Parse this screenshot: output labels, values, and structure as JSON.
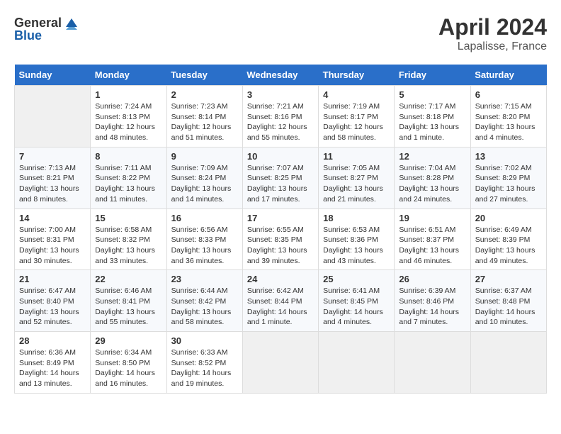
{
  "header": {
    "logo": {
      "general": "General",
      "blue": "Blue"
    },
    "title": "April 2024",
    "location": "Lapalisse, France"
  },
  "calendar": {
    "days_of_week": [
      "Sunday",
      "Monday",
      "Tuesday",
      "Wednesday",
      "Thursday",
      "Friday",
      "Saturday"
    ],
    "weeks": [
      [
        {
          "day": "",
          "sunrise": "",
          "sunset": "",
          "daylight": ""
        },
        {
          "day": "1",
          "sunrise": "Sunrise: 7:24 AM",
          "sunset": "Sunset: 8:13 PM",
          "daylight": "Daylight: 12 hours and 48 minutes."
        },
        {
          "day": "2",
          "sunrise": "Sunrise: 7:23 AM",
          "sunset": "Sunset: 8:14 PM",
          "daylight": "Daylight: 12 hours and 51 minutes."
        },
        {
          "day": "3",
          "sunrise": "Sunrise: 7:21 AM",
          "sunset": "Sunset: 8:16 PM",
          "daylight": "Daylight: 12 hours and 55 minutes."
        },
        {
          "day": "4",
          "sunrise": "Sunrise: 7:19 AM",
          "sunset": "Sunset: 8:17 PM",
          "daylight": "Daylight: 12 hours and 58 minutes."
        },
        {
          "day": "5",
          "sunrise": "Sunrise: 7:17 AM",
          "sunset": "Sunset: 8:18 PM",
          "daylight": "Daylight: 13 hours and 1 minute."
        },
        {
          "day": "6",
          "sunrise": "Sunrise: 7:15 AM",
          "sunset": "Sunset: 8:20 PM",
          "daylight": "Daylight: 13 hours and 4 minutes."
        }
      ],
      [
        {
          "day": "7",
          "sunrise": "Sunrise: 7:13 AM",
          "sunset": "Sunset: 8:21 PM",
          "daylight": "Daylight: 13 hours and 8 minutes."
        },
        {
          "day": "8",
          "sunrise": "Sunrise: 7:11 AM",
          "sunset": "Sunset: 8:22 PM",
          "daylight": "Daylight: 13 hours and 11 minutes."
        },
        {
          "day": "9",
          "sunrise": "Sunrise: 7:09 AM",
          "sunset": "Sunset: 8:24 PM",
          "daylight": "Daylight: 13 hours and 14 minutes."
        },
        {
          "day": "10",
          "sunrise": "Sunrise: 7:07 AM",
          "sunset": "Sunset: 8:25 PM",
          "daylight": "Daylight: 13 hours and 17 minutes."
        },
        {
          "day": "11",
          "sunrise": "Sunrise: 7:05 AM",
          "sunset": "Sunset: 8:27 PM",
          "daylight": "Daylight: 13 hours and 21 minutes."
        },
        {
          "day": "12",
          "sunrise": "Sunrise: 7:04 AM",
          "sunset": "Sunset: 8:28 PM",
          "daylight": "Daylight: 13 hours and 24 minutes."
        },
        {
          "day": "13",
          "sunrise": "Sunrise: 7:02 AM",
          "sunset": "Sunset: 8:29 PM",
          "daylight": "Daylight: 13 hours and 27 minutes."
        }
      ],
      [
        {
          "day": "14",
          "sunrise": "Sunrise: 7:00 AM",
          "sunset": "Sunset: 8:31 PM",
          "daylight": "Daylight: 13 hours and 30 minutes."
        },
        {
          "day": "15",
          "sunrise": "Sunrise: 6:58 AM",
          "sunset": "Sunset: 8:32 PM",
          "daylight": "Daylight: 13 hours and 33 minutes."
        },
        {
          "day": "16",
          "sunrise": "Sunrise: 6:56 AM",
          "sunset": "Sunset: 8:33 PM",
          "daylight": "Daylight: 13 hours and 36 minutes."
        },
        {
          "day": "17",
          "sunrise": "Sunrise: 6:55 AM",
          "sunset": "Sunset: 8:35 PM",
          "daylight": "Daylight: 13 hours and 39 minutes."
        },
        {
          "day": "18",
          "sunrise": "Sunrise: 6:53 AM",
          "sunset": "Sunset: 8:36 PM",
          "daylight": "Daylight: 13 hours and 43 minutes."
        },
        {
          "day": "19",
          "sunrise": "Sunrise: 6:51 AM",
          "sunset": "Sunset: 8:37 PM",
          "daylight": "Daylight: 13 hours and 46 minutes."
        },
        {
          "day": "20",
          "sunrise": "Sunrise: 6:49 AM",
          "sunset": "Sunset: 8:39 PM",
          "daylight": "Daylight: 13 hours and 49 minutes."
        }
      ],
      [
        {
          "day": "21",
          "sunrise": "Sunrise: 6:47 AM",
          "sunset": "Sunset: 8:40 PM",
          "daylight": "Daylight: 13 hours and 52 minutes."
        },
        {
          "day": "22",
          "sunrise": "Sunrise: 6:46 AM",
          "sunset": "Sunset: 8:41 PM",
          "daylight": "Daylight: 13 hours and 55 minutes."
        },
        {
          "day": "23",
          "sunrise": "Sunrise: 6:44 AM",
          "sunset": "Sunset: 8:42 PM",
          "daylight": "Daylight: 13 hours and 58 minutes."
        },
        {
          "day": "24",
          "sunrise": "Sunrise: 6:42 AM",
          "sunset": "Sunset: 8:44 PM",
          "daylight": "Daylight: 14 hours and 1 minute."
        },
        {
          "day": "25",
          "sunrise": "Sunrise: 6:41 AM",
          "sunset": "Sunset: 8:45 PM",
          "daylight": "Daylight: 14 hours and 4 minutes."
        },
        {
          "day": "26",
          "sunrise": "Sunrise: 6:39 AM",
          "sunset": "Sunset: 8:46 PM",
          "daylight": "Daylight: 14 hours and 7 minutes."
        },
        {
          "day": "27",
          "sunrise": "Sunrise: 6:37 AM",
          "sunset": "Sunset: 8:48 PM",
          "daylight": "Daylight: 14 hours and 10 minutes."
        }
      ],
      [
        {
          "day": "28",
          "sunrise": "Sunrise: 6:36 AM",
          "sunset": "Sunset: 8:49 PM",
          "daylight": "Daylight: 14 hours and 13 minutes."
        },
        {
          "day": "29",
          "sunrise": "Sunrise: 6:34 AM",
          "sunset": "Sunset: 8:50 PM",
          "daylight": "Daylight: 14 hours and 16 minutes."
        },
        {
          "day": "30",
          "sunrise": "Sunrise: 6:33 AM",
          "sunset": "Sunset: 8:52 PM",
          "daylight": "Daylight: 14 hours and 19 minutes."
        },
        {
          "day": "",
          "sunrise": "",
          "sunset": "",
          "daylight": ""
        },
        {
          "day": "",
          "sunrise": "",
          "sunset": "",
          "daylight": ""
        },
        {
          "day": "",
          "sunrise": "",
          "sunset": "",
          "daylight": ""
        },
        {
          "day": "",
          "sunrise": "",
          "sunset": "",
          "daylight": ""
        }
      ]
    ]
  }
}
